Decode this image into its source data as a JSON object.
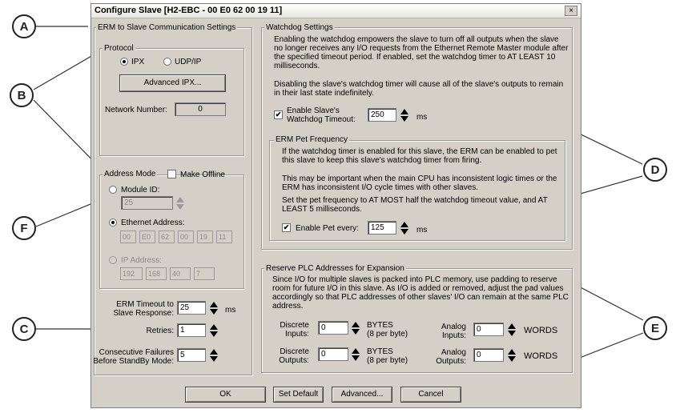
{
  "callouts": [
    "A",
    "B",
    "C",
    "D",
    "E",
    "F"
  ],
  "window": {
    "title": "Configure Slave  [H2-EBC - 00 E0 62 00 19 11]",
    "close_glyph": "×"
  },
  "erm_settings": {
    "legend": "ERM to Slave Communication Settings",
    "protocol": {
      "legend": "Protocol",
      "ipx_label": "IPX",
      "udpip_label": "UDP/IP",
      "selected": "IPX",
      "advanced_ipx_label": "Advanced IPX...",
      "network_number_label": "Network Number:",
      "network_number": "0"
    },
    "address_mode": {
      "legend": "Address Mode",
      "make_offline_label": "Make Offline",
      "module_id_label": "Module ID:",
      "module_id": "25",
      "ethernet_label": "Ethernet Address:",
      "ethernet_octets": [
        "00",
        "E0",
        "62",
        "00",
        "19",
        "11"
      ],
      "ip_label": "IP Address:",
      "ip_octets": [
        "192",
        "168",
        "40",
        "7"
      ],
      "selected": "Ethernet Address"
    },
    "erm_timeout_label_1": "ERM Timeout to",
    "erm_timeout_label_2": "Slave Response:",
    "erm_timeout": "25",
    "erm_timeout_unit": "ms",
    "retries_label": "Retries:",
    "retries": "1",
    "consec_label_1": "Consecutive Failures",
    "consec_label_2": "Before StandBy Mode:",
    "consec": "5"
  },
  "watchdog": {
    "legend": "Watchdog Settings",
    "desc_1": "Enabling the watchdog empowers the slave to turn off all outputs when the slave no longer receives any I/O requests from the Ethernet Remote Master module after the specified timeout period.  If enabled, set the watchdog timer to AT LEAST 10 milliseconds.",
    "desc_2": "Disabling the slave's watchdog timer will cause all of the slave's outputs to remain in their last state indefinitely.",
    "enable_label_1": "Enable Slave's",
    "enable_label_2": "Watchdog Timeout:",
    "enable_checked": true,
    "timeout": "250",
    "timeout_unit": "ms",
    "pet": {
      "legend": "ERM Pet Frequency",
      "desc_1": "If the watchdog timer is enabled for this slave, the ERM can be enabled to pet this slave to keep this slave's watchdog timer from firing.",
      "desc_2": "This may be important when the main CPU has inconsistent logic times or the ERM has inconsistent I/O cycle times with other slaves.",
      "desc_3": "Set the pet frequency to AT MOST half the watchdog timeout value, and AT LEAST 5 milliseconds.",
      "enable_label": "Enable Pet every:",
      "enable_checked": true,
      "value": "125",
      "unit": "ms"
    }
  },
  "reserve": {
    "legend": "Reserve PLC Addresses for Expansion",
    "desc": "Since I/O for multiple slaves is packed into PLC memory, use padding to reserve room for future I/O in this slave.  As I/O is added or removed, adjust the pad values accordingly so that PLC addresses of other slaves' I/O can remain at the same PLC address.",
    "discrete_inputs_label_1": "Discrete",
    "discrete_inputs_label_2": "Inputs:",
    "discrete_inputs": "0",
    "discrete_outputs_label_1": "Discrete",
    "discrete_outputs_label_2": "Outputs:",
    "discrete_outputs": "0",
    "bytes_label": "BYTES",
    "bytes_sub": "(8 per byte)",
    "analog_inputs_label_1": "Analog",
    "analog_inputs_label_2": "Inputs:",
    "analog_inputs": "0",
    "analog_outputs_label_1": "Analog",
    "analog_outputs_label_2": "Outputs:",
    "analog_outputs": "0",
    "words_label": "WORDS"
  },
  "buttons": {
    "ok": "OK",
    "set_default": "Set Default",
    "advanced": "Advanced...",
    "cancel": "Cancel"
  }
}
